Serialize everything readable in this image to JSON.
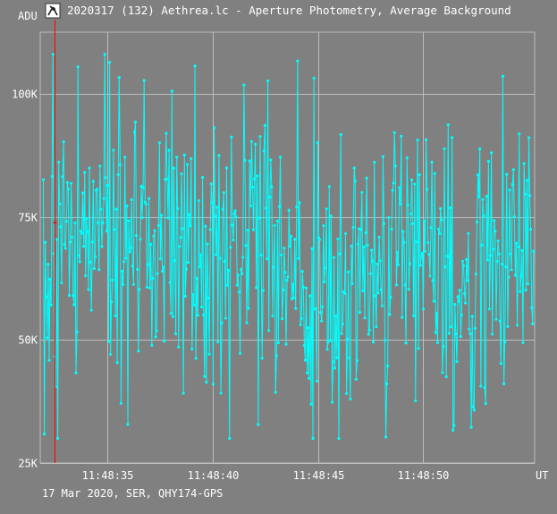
{
  "window": {
    "icon": "telescope-app-icon",
    "title": "2020317 (132) Aethrea.lc - Aperture Photometry, Average Background"
  },
  "footer": {
    "text": "17 Mar 2020, SER, QHY174-GPS"
  },
  "colors": {
    "background": "#808080",
    "grid": "#bdbdbd",
    "series": "#00ffff",
    "cursor": "#ff0000",
    "text": "#ffffff"
  },
  "chart_data": {
    "type": "line",
    "title": "2020317 (132) Aethrea.lc - Aperture Photometry, Average Background",
    "ylabel": "ADU",
    "xlabel": "UT",
    "ylim": [
      25000,
      100000
    ],
    "xlim": [
      "11:48:31.8",
      "11:48:55.3"
    ],
    "y_ticks": [
      {
        "value": 25000,
        "label": "25K"
      },
      {
        "value": 50000,
        "label": "50K"
      },
      {
        "value": 75000,
        "label": "75K"
      },
      {
        "value": 100000,
        "label": "100K"
      }
    ],
    "x_ticks": [
      {
        "value": "11:48:35",
        "label": "11:48:35"
      },
      {
        "value": "11:48:40",
        "label": "11:48:40"
      },
      {
        "value": "11:48:45",
        "label": "11:48:45"
      },
      {
        "value": "11:48:50",
        "label": "11:48:50"
      }
    ],
    "grid": true,
    "cursor_time": "11:48:32.5",
    "marker_points": 512,
    "series": [
      {
        "name": "",
        "sampling": "approximately 22 frames per second between 11:48:31.8 and 11:48:55.3",
        "value_range": [
          30000,
          108000
        ],
        "mean_approx": 68000
      }
    ]
  }
}
